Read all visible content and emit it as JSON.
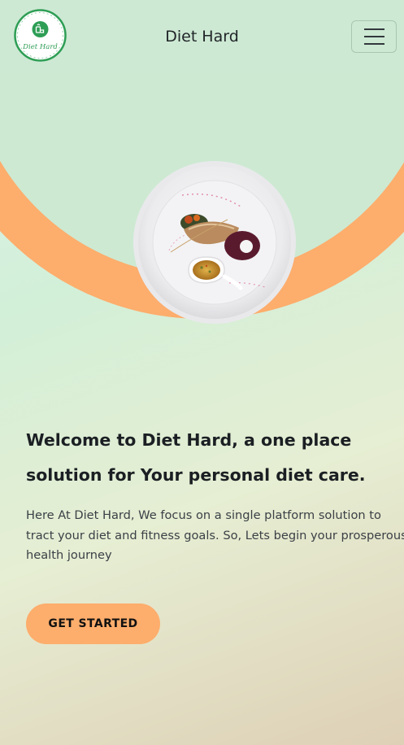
{
  "navbar": {
    "logo_text": "Diet Hard",
    "brand": "Diet Hard",
    "menu_icon": "hamburger-menu-icon"
  },
  "hero": {
    "image": "food-plate-image",
    "headline": "Welcome to Diet Hard, a one place solution for Your personal diet care.",
    "intro": "Here At Diet Hard, We focus on a single platform solution to tract your diet and fitness goals. So, Lets begin your prosperous health journey",
    "cta_label": "GET STARTED"
  },
  "colors": {
    "accent": "#fdad6c",
    "navbar_bg": "#cde9d3",
    "logo_green": "#2e9e55"
  }
}
